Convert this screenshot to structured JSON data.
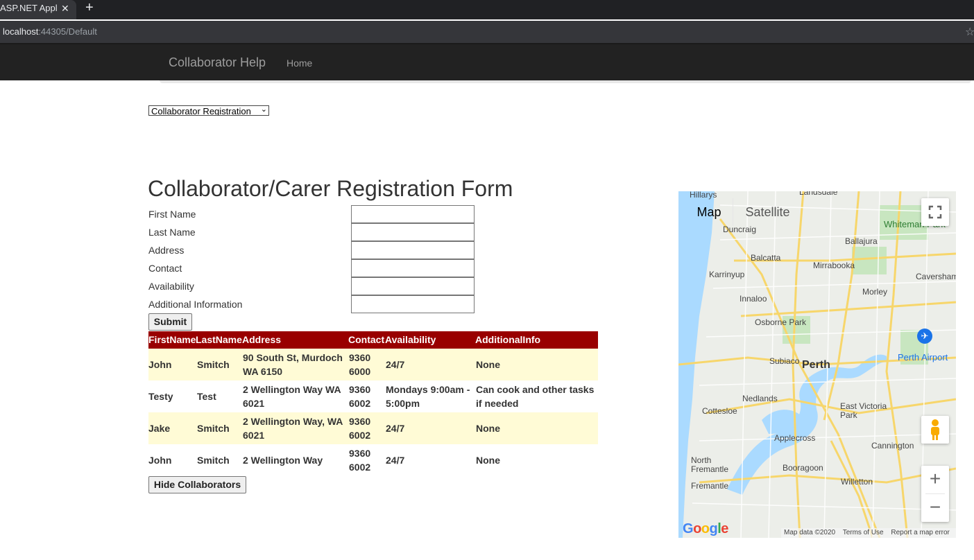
{
  "browser": {
    "tab_title": "ASP.NET Applic",
    "tab_close": "✕",
    "new_tab": "+",
    "url_host": "localhost",
    "url_path": ":44305/Default"
  },
  "navbar": {
    "brand": "Collaborator Help",
    "home": "Home"
  },
  "page_select": {
    "selected": "Collaborator Registration"
  },
  "form": {
    "title": "Collaborator/Carer Registration Form",
    "fields": [
      {
        "label": "First Name",
        "value": ""
      },
      {
        "label": "Last Name",
        "value": ""
      },
      {
        "label": "Address",
        "value": ""
      },
      {
        "label": "Contact",
        "value": ""
      },
      {
        "label": "Availability",
        "value": ""
      },
      {
        "label": "Additional Information",
        "value": ""
      }
    ],
    "submit_label": "Submit"
  },
  "grid": {
    "headers": [
      "FirstName",
      "LastName",
      "Address",
      "Contact",
      "Availability",
      "AdditionalInfo"
    ],
    "rows": [
      {
        "first": "John",
        "last": "Smitch",
        "address": "90 South St, Murdoch WA 6150",
        "contact": "9360 6000",
        "availability": "24/7",
        "info": "None"
      },
      {
        "first": "Testy",
        "last": "Test",
        "address": "2 Wellington Way WA 6021",
        "contact": "9360 6002",
        "availability": "Mondays 9:00am - 5:00pm",
        "info": "Can cook and other tasks if needed"
      },
      {
        "first": "Jake",
        "last": "Smitch",
        "address": "2 Wellington Way, WA 6021",
        "contact": "9360 6002",
        "availability": "24/7",
        "info": "None"
      },
      {
        "first": "John",
        "last": "Smitch",
        "address": "2 Wellington Way",
        "contact": "9360 6002",
        "availability": "24/7",
        "info": "None"
      }
    ],
    "hide_label": "Hide Collaborators"
  },
  "map": {
    "type_map": "Map",
    "type_satellite": "Satellite",
    "zoom_in": "+",
    "zoom_out": "−",
    "places": {
      "perth": "Perth",
      "perth_airport": "Perth Airport",
      "subiaco": "Subiaco",
      "nedlands": "Nedlands",
      "cottesloe": "Cottesloe",
      "applecross": "Applecross",
      "booragoon": "Booragoon",
      "north_fremantle": "North Fremantle",
      "fremantle": "Fremantle",
      "willetton": "Willetton",
      "cannington": "Cannington",
      "east_victoria_park": "East Victoria Park",
      "osborne_park": "Osborne Park",
      "innaloo": "Innaloo",
      "karrinyup": "Karrinyup",
      "balcatta": "Balcatta",
      "mirrabooka": "Mirrabooka",
      "morley": "Morley",
      "ballajura": "Ballajura",
      "duncraig": "Duncraig",
      "whiteman_park": "Whiteman Park",
      "caversham": "Caversham",
      "hillarys": "Hillarys",
      "landsdale": "Landsdale"
    },
    "google": "Google",
    "map_data": "Map data ©2020",
    "terms": "Terms of Use",
    "report": "Report a map error"
  }
}
